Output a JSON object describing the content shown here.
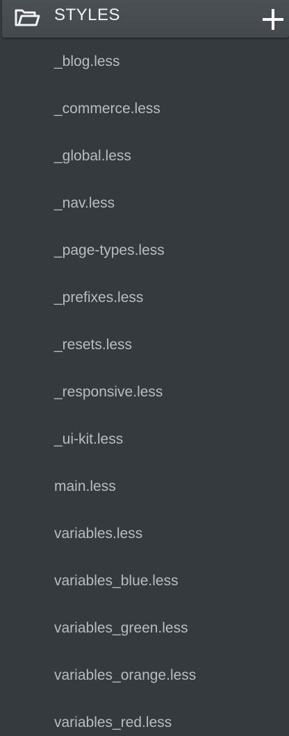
{
  "header": {
    "title": "STYLES",
    "folder_icon": "folder-open-icon",
    "add_icon": "plus-icon"
  },
  "files": [
    "_blog.less",
    "_commerce.less",
    "_global.less",
    "_nav.less",
    "_page-types.less",
    "_prefixes.less",
    "_resets.less",
    "_responsive.less",
    "_ui-kit.less",
    "main.less",
    "variables.less",
    "variables_blue.less",
    "variables_green.less",
    "variables_orange.less",
    "variables_red.less"
  ],
  "colors": {
    "background": "#343a3d",
    "header": "#474d50",
    "text": "#b6bec2",
    "title": "#f2f4f5"
  }
}
